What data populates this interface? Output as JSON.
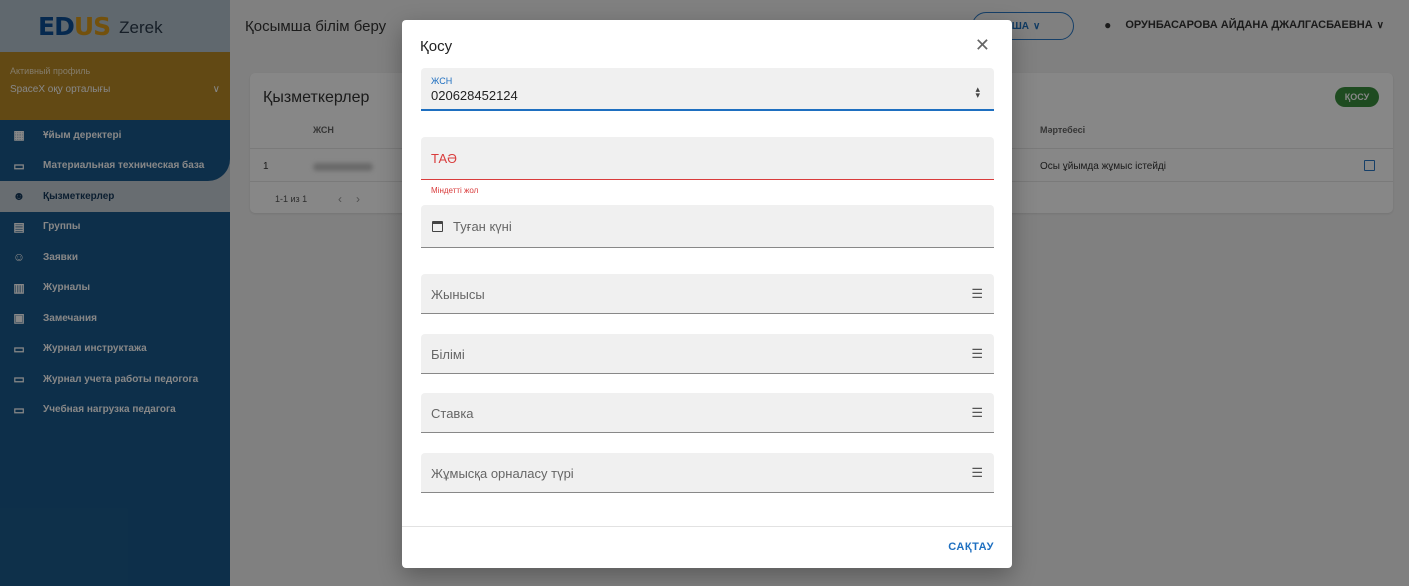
{
  "app": {
    "logo_main": "EDUS",
    "logo_name": "Zerek",
    "header_title": "Қосымша білім беру",
    "lang_label": "ҚША",
    "user_name": "ОРУНБАСАРОВА АЙДАНА ДЖАЛГАСБАЕВНА"
  },
  "profile": {
    "label": "Активный профиль",
    "value": "SpaceX оқу орталығы"
  },
  "sidebar": {
    "items": [
      {
        "label": "Ұйым деректері",
        "icon": "building-icon"
      },
      {
        "label": "Материальная техническая база",
        "icon": "devices-icon"
      },
      {
        "label": "Қызметкерлер",
        "icon": "people-icon",
        "active": true
      },
      {
        "label": "Группы",
        "icon": "group-icon"
      },
      {
        "label": "Заявки",
        "icon": "person-check-icon"
      },
      {
        "label": "Журналы",
        "icon": "book-icon"
      },
      {
        "label": "Замечания",
        "icon": "comment-icon"
      },
      {
        "label": "Журнал инструктажа",
        "icon": "monitor-icon"
      },
      {
        "label": "Журнал учета работы педогога",
        "icon": "monitor-icon"
      },
      {
        "label": "Учебная нагрузка педагога",
        "icon": "monitor-icon"
      }
    ]
  },
  "main": {
    "card_title": "Қызметкерлер",
    "add_label": "ҚОСУ",
    "columns": [
      "ЖСН",
      "Мәртебесі"
    ],
    "row": {
      "num": "1",
      "status": "Осы ұйымда жұмыс істейді"
    },
    "pager_text": "1-1 из 1"
  },
  "dialog": {
    "title": "Қосу",
    "iin_label": "ЖСН",
    "iin_value": "020628452124",
    "fio_label": "ТАӘ",
    "fio_error": "Міндетті жол",
    "birth_label": "Туған күні",
    "sex_label": "Жынысы",
    "edu_label": "Білімі",
    "rate_label": "Ставка",
    "emp_label": "Жұмысқа орналасу түрі",
    "save_label": "САҚТАУ"
  },
  "colors": {
    "sidebar": "#1a5a8c",
    "accent": "#1e6fc0",
    "error": "#d93c3c",
    "profile": "#b98a26",
    "add_button": "#3a8f3e"
  }
}
